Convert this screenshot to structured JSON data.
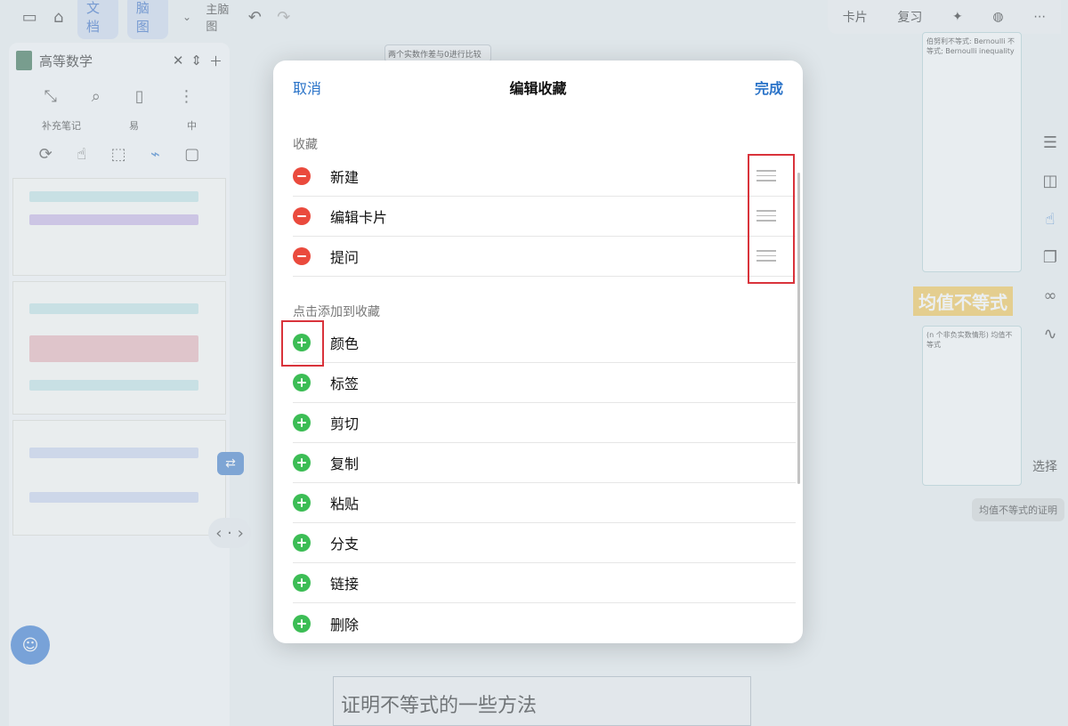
{
  "topbar": {
    "doc_tab": "文档",
    "mindmap_tab": "脑图",
    "theme_label": "主脑图"
  },
  "right_top": {
    "card": "卡片",
    "review": "复习"
  },
  "left_panel": {
    "book_title": "高等数学",
    "mode_labels": [
      "补充笔记",
      "易",
      "中"
    ]
  },
  "canvas": {
    "top_node": "两个实数作差与0进行比较",
    "yellow_title": "均值不等式",
    "pill_node": "均值不等式的证明",
    "bottom_heading": "证明不等式的一些方法",
    "right_card_title": "伯努利不等式: Bernoulli 不等式; Bernoulli inequality",
    "right_card2_title": "(n 个非负实数情形) 均值不等式",
    "select_label": "选择"
  },
  "modal": {
    "cancel": "取消",
    "title": "编辑收藏",
    "done": "完成",
    "favorites_label": "收藏",
    "favorites": [
      {
        "label": "新建"
      },
      {
        "label": "编辑卡片"
      },
      {
        "label": "提问"
      }
    ],
    "add_label": "点击添加到收藏",
    "available": [
      {
        "label": "颜色"
      },
      {
        "label": "标签"
      },
      {
        "label": "剪切"
      },
      {
        "label": "复制"
      },
      {
        "label": "粘贴"
      },
      {
        "label": "分支"
      },
      {
        "label": "链接"
      },
      {
        "label": "删除"
      }
    ]
  },
  "colors": {
    "accent": "#2a73c8",
    "remove": "#ea4a3d",
    "add": "#3cbd55",
    "annotation": "#d9333b"
  }
}
